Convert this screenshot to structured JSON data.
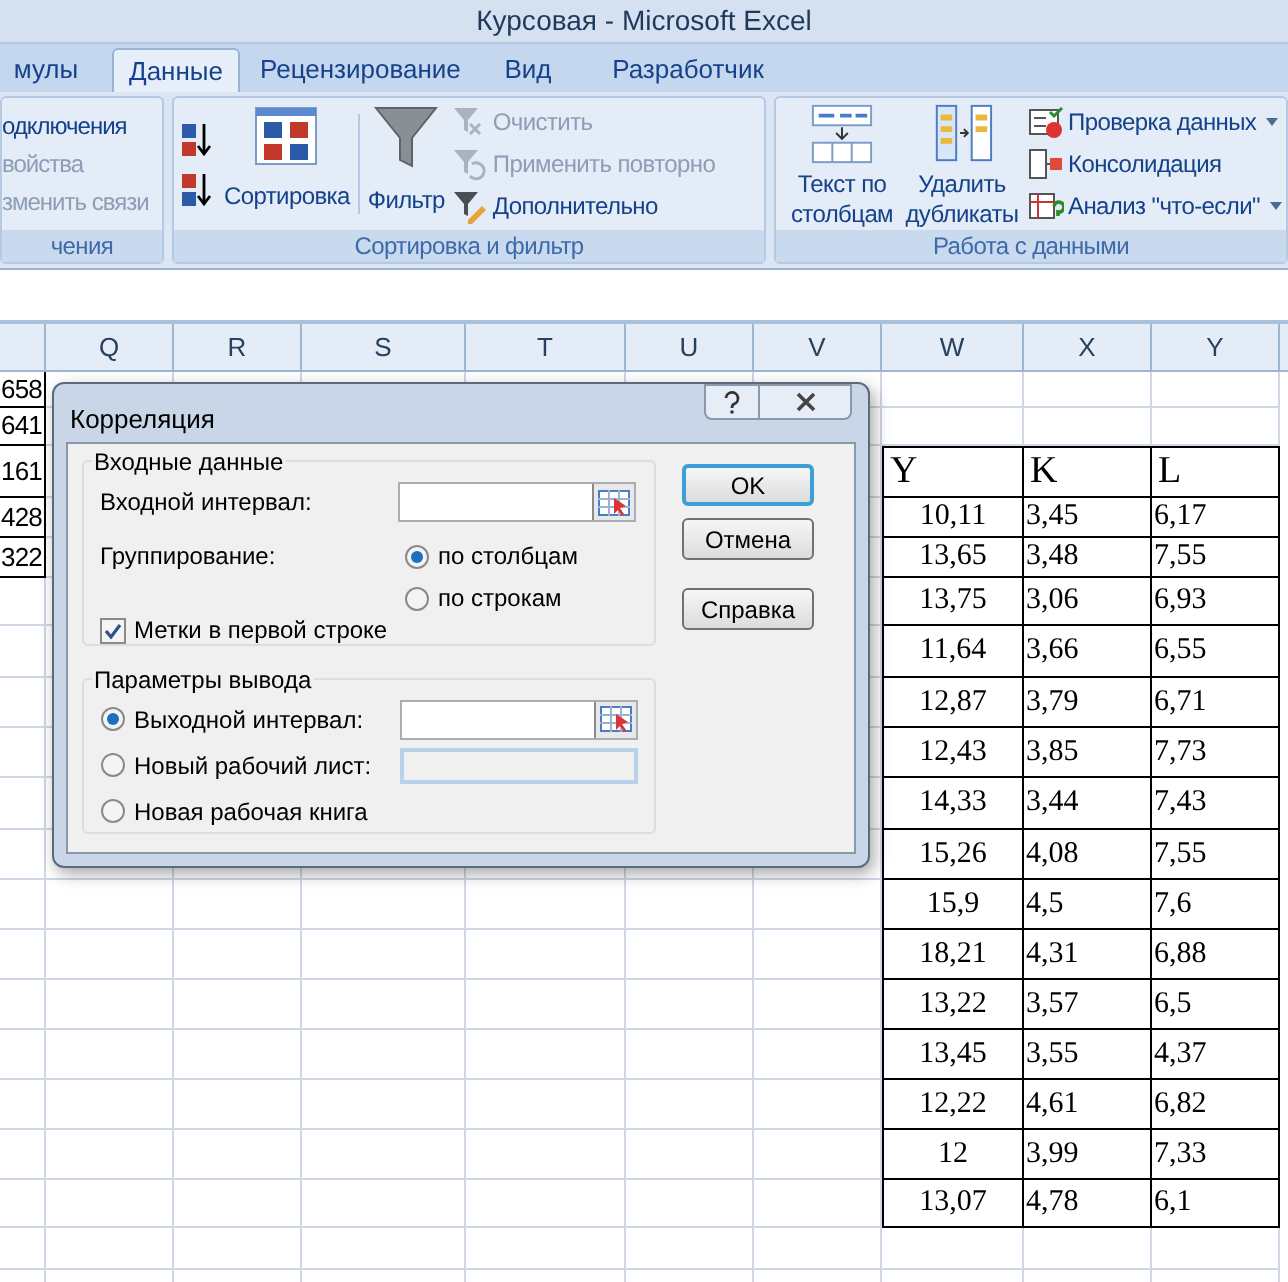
{
  "window": {
    "title": "Курсовая - Microsoft Excel"
  },
  "tabs": [
    {
      "label": "мулы",
      "selected": false
    },
    {
      "label": "Данные",
      "selected": true
    },
    {
      "label": "Рецензирование",
      "selected": false
    },
    {
      "label": "Вид",
      "selected": false
    },
    {
      "label": "Разработчик",
      "selected": false
    }
  ],
  "ribbon": {
    "groups": [
      {
        "label": "чения",
        "items": [
          {
            "label": "одключения",
            "disabled": false
          },
          {
            "label": "войства",
            "disabled": true
          },
          {
            "label": "зменить связи",
            "disabled": true
          }
        ]
      },
      {
        "label": "Сортировка и фильтр",
        "items": [
          {
            "label": "Сортировка",
            "disabled": false
          },
          {
            "label": "Фильтр",
            "disabled": false
          },
          {
            "label": "Очистить",
            "disabled": true
          },
          {
            "label": "Применить повторно",
            "disabled": true
          },
          {
            "label": "Дополнительно",
            "disabled": false
          }
        ]
      },
      {
        "label": "Работа с данными",
        "items": [
          {
            "label": "Текст по столбцам",
            "disabled": false
          },
          {
            "label": "Удалить дубликаты",
            "disabled": false
          },
          {
            "label": "Проверка данных",
            "disabled": false,
            "has_menu": true
          },
          {
            "label": "Консолидация",
            "disabled": false,
            "has_menu": false
          },
          {
            "label": "Анализ \"что-если\"",
            "disabled": false,
            "has_menu": true
          }
        ]
      }
    ]
  },
  "sheet": {
    "columns": [
      "Q",
      "R",
      "S",
      "T",
      "U",
      "V",
      "W",
      "X",
      "Y"
    ],
    "left_column_values": [
      "658",
      "641",
      "161",
      "428",
      "322"
    ],
    "table": {
      "header": [
        "Y",
        "K",
        "L"
      ],
      "rows": [
        [
          "10,11",
          "3,45",
          "6,17"
        ],
        [
          "13,65",
          "3,48",
          "7,55"
        ],
        [
          "13,75",
          "3,06",
          "6,93"
        ],
        [
          "11,64",
          "3,66",
          "6,55"
        ],
        [
          "12,87",
          "3,79",
          "6,71"
        ],
        [
          "12,43",
          "3,85",
          "7,73"
        ],
        [
          "14,33",
          "3,44",
          "7,43"
        ],
        [
          "15,26",
          "4,08",
          "7,55"
        ],
        [
          "15,9",
          "4,5",
          "7,6"
        ],
        [
          "18,21",
          "4,31",
          "6,88"
        ],
        [
          "13,22",
          "3,57",
          "6,5"
        ],
        [
          "13,45",
          "3,55",
          "4,37"
        ],
        [
          "12,22",
          "4,61",
          "6,82"
        ],
        [
          "12",
          "3,99",
          "7,33"
        ],
        [
          "13,07",
          "4,78",
          "6,1"
        ]
      ]
    }
  },
  "dialog": {
    "title": "Корреляция",
    "input_group": {
      "label": "Входные данные",
      "input_range_label": "Входной интервал:",
      "grouping_label": "Группирование:",
      "grouping_options": [
        {
          "label": "по столбцам",
          "selected": true
        },
        {
          "label": "по строкам",
          "selected": false
        }
      ],
      "labels_checkbox": {
        "label": "Метки в первой строке",
        "checked": true
      }
    },
    "output_group": {
      "label": "Параметры вывода",
      "options": [
        {
          "label": "Выходной интервал:",
          "selected": true,
          "kind": "range"
        },
        {
          "label": "Новый рабочий лист:",
          "selected": false,
          "kind": "disabled_field"
        },
        {
          "label": "Новая рабочая книга",
          "selected": false,
          "kind": "plain"
        }
      ]
    },
    "buttons": [
      {
        "label": "OK",
        "default": true
      },
      {
        "label": "Отмена",
        "default": false
      },
      {
        "label": "Справка",
        "default": false
      }
    ]
  }
}
